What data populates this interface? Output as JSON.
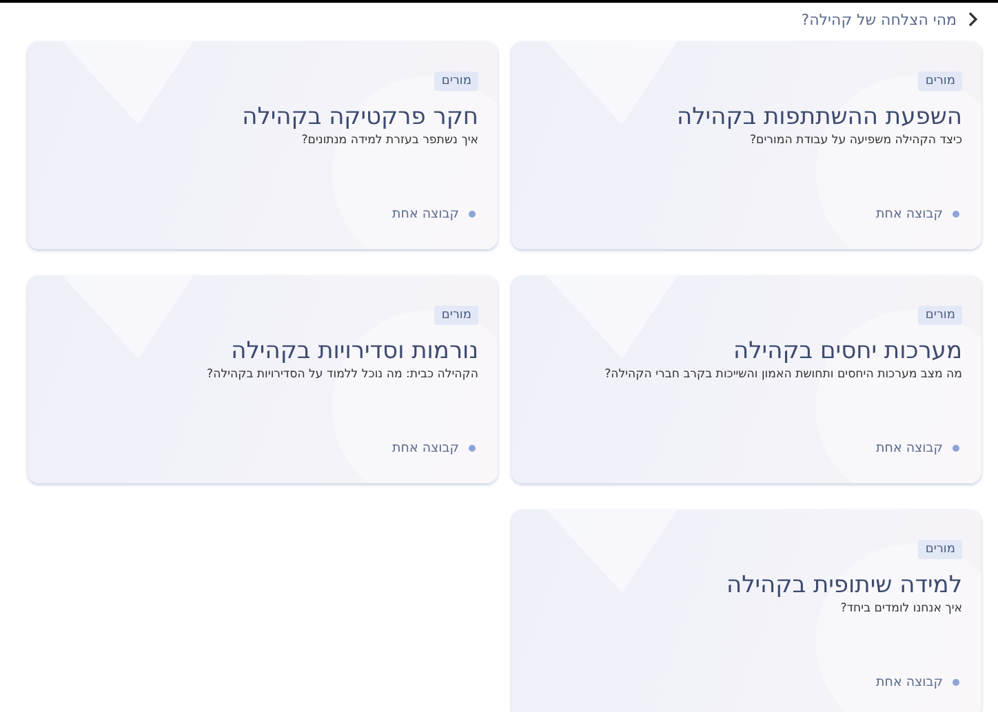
{
  "header": {
    "title": "מהי הצלחה של קהילה?"
  },
  "cards": [
    {
      "tag": "מורים",
      "title": "השפעת ההשתתפות בקהילה",
      "subtitle": "כיצד הקהילה משפיעה על עבודת המורים?",
      "group": "קבוצה אחת"
    },
    {
      "tag": "מורים",
      "title": "חקר פרקטיקה בקהילה",
      "subtitle": "איך נשתפר בעזרת למידה מנתונים?",
      "group": "קבוצה אחת"
    },
    {
      "tag": "מורים",
      "title": "מערכות יחסים בקהילה",
      "subtitle": "מה מצב מערכות היחסים ותחושת האמון והשייכות בקרב חברי הקהילה?",
      "group": "קבוצה אחת"
    },
    {
      "tag": "מורים",
      "title": "נורמות וסדירויות בקהילה",
      "subtitle": "הקהילה כבית: מה נוכל ללמוד על הסדירויות בקהילה?",
      "group": "קבוצה אחת"
    },
    {
      "tag": "מורים",
      "title": "למידה שיתופית בקהילה",
      "subtitle": "איך אנחנו לומדים ביחד?",
      "group": "קבוצה אחת"
    }
  ]
}
